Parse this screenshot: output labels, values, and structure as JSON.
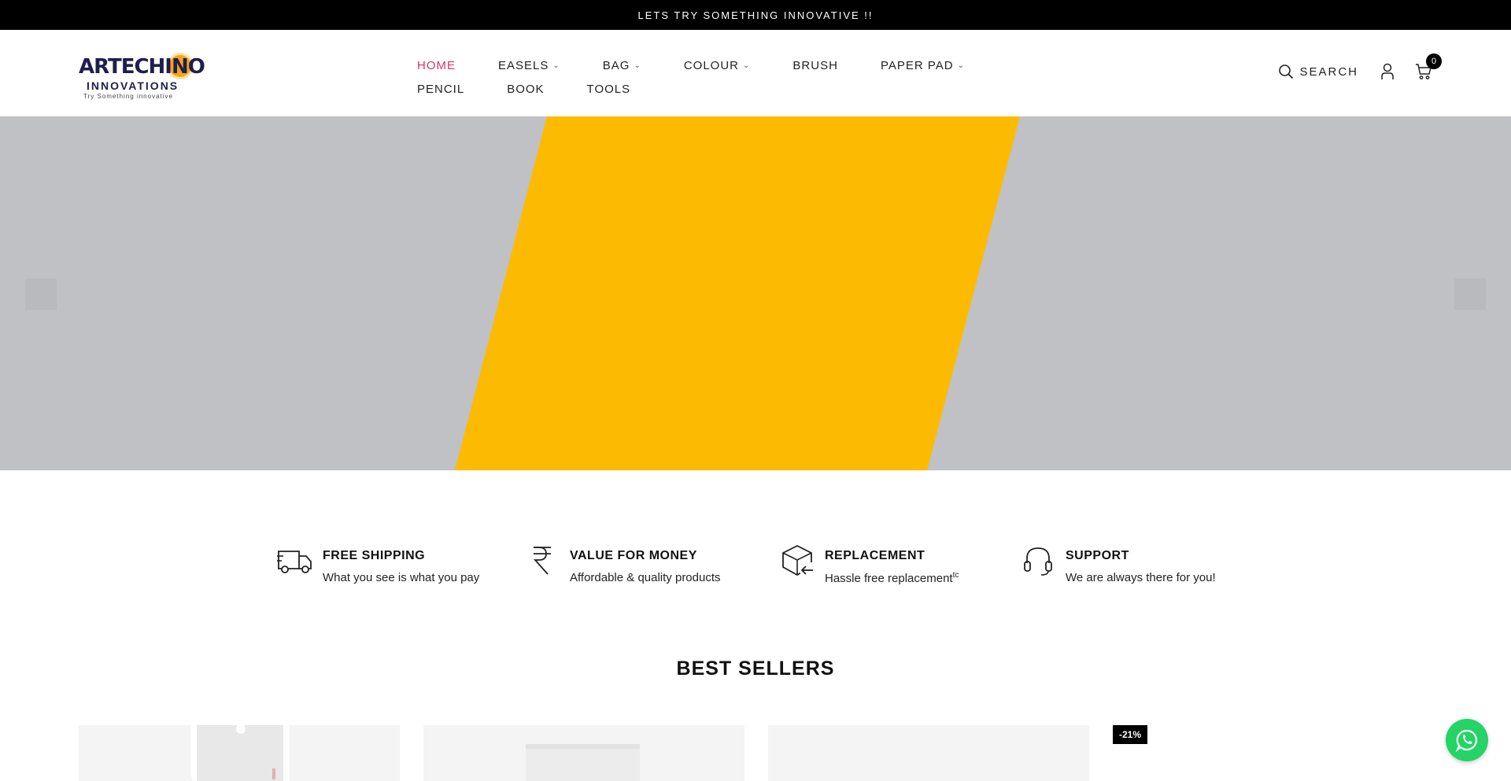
{
  "announcement": {
    "text": "LETS TRY SOMETHING INNOVATIVE !!"
  },
  "brand": {
    "word": "ARTECHINO",
    "sub": "INNOVATIONS",
    "tagline": "Try Something innovative"
  },
  "nav": {
    "row1": [
      {
        "label": "HOME",
        "active": true,
        "dropdown": false
      },
      {
        "label": "EASELS",
        "active": false,
        "dropdown": true
      },
      {
        "label": "BAG",
        "active": false,
        "dropdown": true
      },
      {
        "label": "COLOUR",
        "active": false,
        "dropdown": true
      },
      {
        "label": "BRUSH",
        "active": false,
        "dropdown": false
      },
      {
        "label": "PAPER PAD",
        "active": false,
        "dropdown": true
      }
    ],
    "row2": [
      {
        "label": "PENCIL"
      },
      {
        "label": "BOOK"
      },
      {
        "label": "TOOLS"
      }
    ]
  },
  "header_tools": {
    "search_label": "SEARCH",
    "cart_count": "0"
  },
  "hero": {
    "background_color": "#bfc1c4",
    "band_color": "#fcbb00"
  },
  "features": [
    {
      "icon": "truck-icon",
      "title": "FREE SHIPPING",
      "desc": "What you see is what you pay",
      "sup": ""
    },
    {
      "icon": "rupee-icon",
      "title": "VALUE FOR MONEY",
      "desc": "Affordable & quality products",
      "sup": ""
    },
    {
      "icon": "box-return-icon",
      "title": "REPLACEMENT",
      "desc": "Hassle free replacement",
      "sup": "tc"
    },
    {
      "icon": "headset-icon",
      "title": "SUPPORT",
      "desc": "We are always there for you!",
      "sup": ""
    }
  ],
  "best_sellers": {
    "title": "BEST SELLERS",
    "badge": "-21%"
  },
  "colors": {
    "accent": "#d6336c",
    "whatsapp": "#25d366"
  }
}
